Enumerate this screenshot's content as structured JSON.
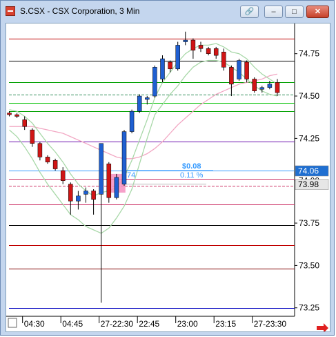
{
  "window": {
    "title": "S.CSX - CSX Corporation, 3 Min",
    "buttons": {
      "link": "🔗",
      "minimize": "–",
      "maximize": "□",
      "close": "✕"
    }
  },
  "chart_data": {
    "type": "candlestick",
    "title": "S.CSX - CSX Corporation, 3 Min",
    "ylim": [
      73.2,
      74.92
    ],
    "y_ticks": [
      "74.75",
      "74.50",
      "74.25",
      "74.00",
      "73.75",
      "73.50",
      "73.25"
    ],
    "x_ticks": [
      "04:30",
      "04:45",
      "27-22:30",
      "22:45",
      "23:00",
      "23:15",
      "27-23:30"
    ],
    "price_badges": [
      {
        "label": "74.06",
        "value": 74.06,
        "color": "#1f6fd1",
        "text_color": "#ffffff"
      },
      {
        "label": "73.98",
        "value": 73.98,
        "color": "#e6e6e6",
        "text_color": "#000000"
      }
    ],
    "measure_annotation": {
      "change": "$0.08",
      "percent": "0.11 %",
      "start_label": "74"
    },
    "horizontal_lines": [
      {
        "value": 74.84,
        "color": "#c00000"
      },
      {
        "value": 74.71,
        "color": "#000000"
      },
      {
        "value": 74.58,
        "color": "#00a000"
      },
      {
        "value": 74.51,
        "color": "#2e8b57",
        "dashed": true
      },
      {
        "value": 74.46,
        "color": "#00c000"
      },
      {
        "value": 74.41,
        "color": "#00a000"
      },
      {
        "value": 74.23,
        "color": "#6a0dad"
      },
      {
        "value": 74.06,
        "color": "#3399ff"
      },
      {
        "value": 74.01,
        "color": "#cc3366"
      },
      {
        "value": 73.97,
        "color": "#cc3366",
        "dashed": true
      },
      {
        "value": 73.86,
        "color": "#cc3366"
      },
      {
        "value": 73.74,
        "color": "#000000"
      },
      {
        "value": 73.62,
        "color": "#c00000"
      },
      {
        "value": 73.48,
        "color": "#800000"
      },
      {
        "value": 73.25,
        "color": "#0000c0"
      }
    ],
    "candles": [
      {
        "o": 74.4,
        "h": 74.41,
        "l": 74.38,
        "c": 74.39
      },
      {
        "o": 74.39,
        "h": 74.4,
        "l": 74.37,
        "c": 74.38
      },
      {
        "o": 74.36,
        "h": 74.38,
        "l": 74.3,
        "c": 74.32
      },
      {
        "o": 74.3,
        "h": 74.31,
        "l": 74.2,
        "c": 74.22
      },
      {
        "o": 74.22,
        "h": 74.23,
        "l": 74.12,
        "c": 74.14
      },
      {
        "o": 74.14,
        "h": 74.15,
        "l": 74.1,
        "c": 74.11
      },
      {
        "o": 74.12,
        "h": 74.13,
        "l": 74.06,
        "c": 74.07
      },
      {
        "o": 74.06,
        "h": 74.08,
        "l": 73.98,
        "c": 74.0
      },
      {
        "o": 73.98,
        "h": 73.99,
        "l": 73.8,
        "c": 73.88
      },
      {
        "o": 73.88,
        "h": 73.94,
        "l": 73.83,
        "c": 73.91
      },
      {
        "o": 73.92,
        "h": 73.96,
        "l": 73.87,
        "c": 73.94
      },
      {
        "o": 73.94,
        "h": 73.95,
        "l": 73.8,
        "c": 73.89
      },
      {
        "o": 73.92,
        "h": 74.22,
        "l": 73.28,
        "c": 74.22
      },
      {
        "o": 74.1,
        "h": 74.11,
        "l": 73.87,
        "c": 73.9
      },
      {
        "o": 73.9,
        "h": 74.04,
        "l": 73.89,
        "c": 74.02
      },
      {
        "o": 73.98,
        "h": 74.3,
        "l": 73.97,
        "c": 74.29
      },
      {
        "o": 74.29,
        "h": 74.42,
        "l": 74.28,
        "c": 74.41
      },
      {
        "o": 74.41,
        "h": 74.51,
        "l": 74.4,
        "c": 74.5
      },
      {
        "o": 74.48,
        "h": 74.5,
        "l": 74.45,
        "c": 74.49
      },
      {
        "o": 74.5,
        "h": 74.68,
        "l": 74.49,
        "c": 74.67
      },
      {
        "o": 74.6,
        "h": 74.74,
        "l": 74.58,
        "c": 74.72
      },
      {
        "o": 74.7,
        "h": 74.71,
        "l": 74.64,
        "c": 74.66
      },
      {
        "o": 74.66,
        "h": 74.82,
        "l": 74.65,
        "c": 74.8
      },
      {
        "o": 74.82,
        "h": 74.88,
        "l": 74.8,
        "c": 74.83
      },
      {
        "o": 74.83,
        "h": 74.84,
        "l": 74.72,
        "c": 74.77
      },
      {
        "o": 74.8,
        "h": 74.82,
        "l": 74.76,
        "c": 74.78
      },
      {
        "o": 74.78,
        "h": 74.79,
        "l": 74.74,
        "c": 74.75
      },
      {
        "o": 74.78,
        "h": 74.79,
        "l": 74.72,
        "c": 74.74
      },
      {
        "o": 74.76,
        "h": 74.78,
        "l": 74.65,
        "c": 74.67
      },
      {
        "o": 74.67,
        "h": 74.68,
        "l": 74.5,
        "c": 74.57
      },
      {
        "o": 74.6,
        "h": 74.72,
        "l": 74.59,
        "c": 74.71
      },
      {
        "o": 74.7,
        "h": 74.71,
        "l": 74.58,
        "c": 74.6
      },
      {
        "o": 74.6,
        "h": 74.61,
        "l": 74.52,
        "c": 74.53
      },
      {
        "o": 74.54,
        "h": 74.56,
        "l": 74.52,
        "c": 74.55
      },
      {
        "o": 74.55,
        "h": 74.59,
        "l": 74.54,
        "c": 74.57
      },
      {
        "o": 74.58,
        "h": 74.6,
        "l": 74.5,
        "c": 74.52
      }
    ],
    "lines": [
      {
        "name": "",
        "color": "#f2a7c3",
        "values": [
          74.32,
          74.32,
          74.32,
          74.32,
          74.31,
          74.3,
          74.29,
          74.28,
          74.26,
          74.24,
          74.22,
          74.2,
          74.18,
          74.16,
          74.14,
          74.13,
          74.13,
          74.14,
          74.16,
          74.19,
          74.23,
          74.28,
          74.33,
          74.37,
          74.41,
          74.45,
          74.48,
          74.51,
          74.53,
          74.55,
          74.57,
          74.58,
          74.59,
          74.6,
          74.62,
          74.63
        ]
      },
      {
        "name": "",
        "color": "#a8d8a8",
        "values": [
          74.42,
          74.41,
          74.38,
          74.34,
          74.28,
          74.22,
          74.17,
          74.11,
          74.04,
          73.98,
          73.94,
          73.91,
          73.93,
          73.94,
          73.96,
          74.02,
          74.12,
          74.24,
          74.36,
          74.49,
          74.58,
          74.64,
          74.7,
          74.75,
          74.78,
          74.8,
          74.8,
          74.81,
          74.79,
          74.76,
          74.75,
          74.72,
          74.67,
          74.63,
          74.6,
          74.57
        ]
      },
      {
        "name": "",
        "color": "#a8d8a8",
        "values": [
          74.3,
          74.26,
          74.2,
          74.13,
          74.05,
          73.98,
          73.92,
          73.86,
          73.8,
          73.77,
          73.73,
          73.71,
          73.69,
          73.72,
          73.78,
          73.85,
          73.95,
          74.1,
          74.25,
          74.39,
          74.45,
          74.51,
          74.56,
          74.62,
          74.67,
          74.7,
          74.71,
          74.71,
          74.7,
          74.67,
          74.64,
          74.6,
          74.56,
          74.53,
          74.51,
          74.5
        ]
      }
    ]
  }
}
